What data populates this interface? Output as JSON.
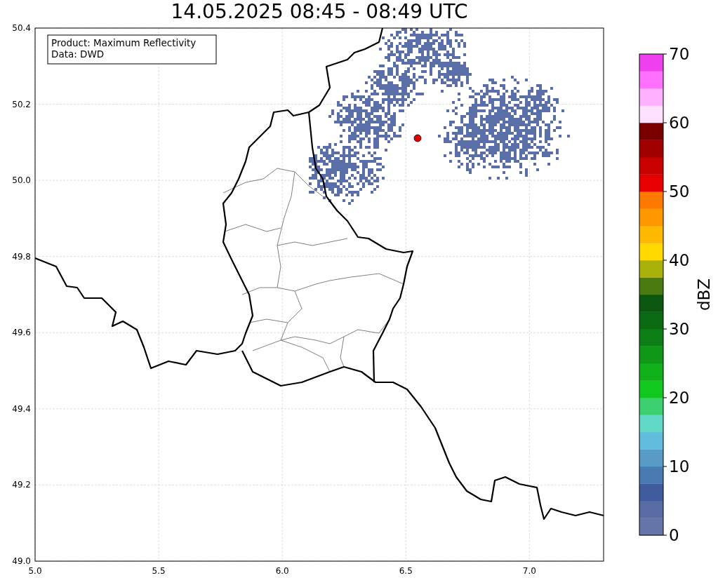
{
  "title": "14.05.2025 08:45 - 08:49 UTC",
  "map": {
    "info_box": [
      "Product: Maximum Reflectivity",
      "Data: DWD"
    ],
    "xticks": [
      "5.0",
      "5.5",
      "6.0",
      "6.5",
      "7.0"
    ],
    "yticks": [
      "50.4",
      "50.2",
      "50.0",
      "49.8",
      "49.6",
      "49.4",
      "49.2",
      "49.0"
    ]
  },
  "colorbar": {
    "label": "dBZ",
    "ticks": [
      "70",
      "60",
      "50",
      "40",
      "30",
      "20",
      "10",
      "0"
    ],
    "segments": [
      {
        "color": "#6676a8"
      },
      {
        "color": "#5a6ca4"
      },
      {
        "color": "#405c9e"
      },
      {
        "color": "#4a7ab2"
      },
      {
        "color": "#5a9cc8"
      },
      {
        "color": "#62bcdc"
      },
      {
        "color": "#62d8c8"
      },
      {
        "color": "#3cd070"
      },
      {
        "color": "#10c820"
      },
      {
        "color": "#10b018"
      },
      {
        "color": "#109818"
      },
      {
        "color": "#0c8016"
      },
      {
        "color": "#0a6a12"
      },
      {
        "color": "#0a5810"
      },
      {
        "color": "#4a7a10"
      },
      {
        "color": "#aab00a"
      },
      {
        "color": "#ffd800"
      },
      {
        "color": "#ffb800"
      },
      {
        "color": "#ff9800"
      },
      {
        "color": "#ff7800"
      },
      {
        "color": "#e80000"
      },
      {
        "color": "#c80000"
      },
      {
        "color": "#a00000"
      },
      {
        "color": "#780000"
      },
      {
        "color": "#ffe0ff"
      },
      {
        "color": "#ffb0ff"
      },
      {
        "color": "#ff70ff"
      },
      {
        "color": "#ee40ee"
      }
    ]
  }
}
